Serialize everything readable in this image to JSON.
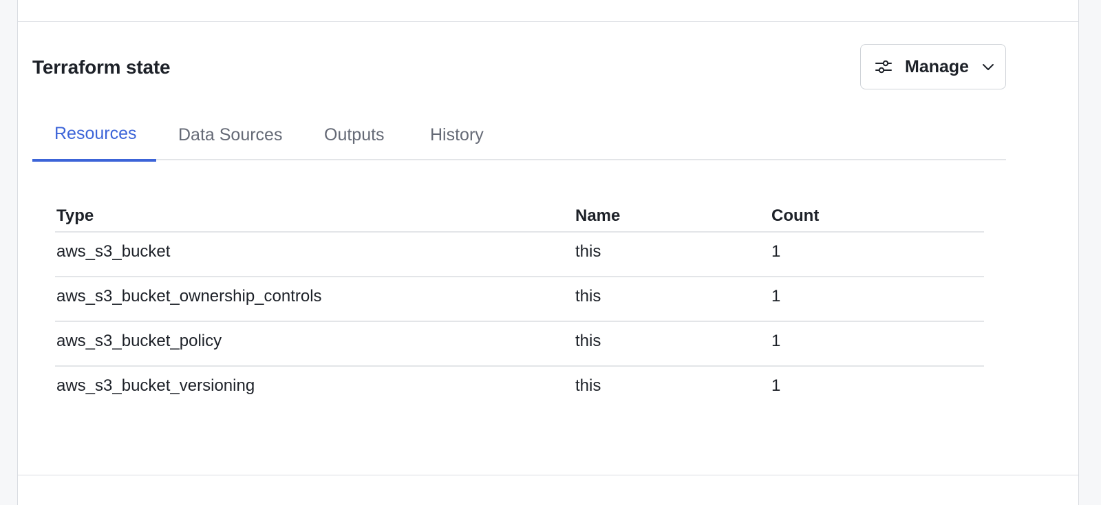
{
  "panel": {
    "title": "Terraform state",
    "manage_button": {
      "label": "Manage",
      "icon": "sliders-icon",
      "dropdown_icon": "chevron-down-icon"
    }
  },
  "tabs": [
    {
      "label": "Resources",
      "active": true
    },
    {
      "label": "Data Sources",
      "active": false
    },
    {
      "label": "Outputs",
      "active": false
    },
    {
      "label": "History",
      "active": false
    }
  ],
  "table": {
    "columns": [
      "Type",
      "Name",
      "Count"
    ],
    "rows": [
      {
        "type": "aws_s3_bucket",
        "name": "this",
        "count": "1"
      },
      {
        "type": "aws_s3_bucket_ownership_controls",
        "name": "this",
        "count": "1"
      },
      {
        "type": "aws_s3_bucket_policy",
        "name": "this",
        "count": "1"
      },
      {
        "type": "aws_s3_bucket_versioning",
        "name": "this",
        "count": "1"
      }
    ]
  },
  "colors": {
    "accent": "#3c64d8",
    "text": "#1d2128",
    "muted": "#656a76",
    "border": "#e3e5e8"
  }
}
